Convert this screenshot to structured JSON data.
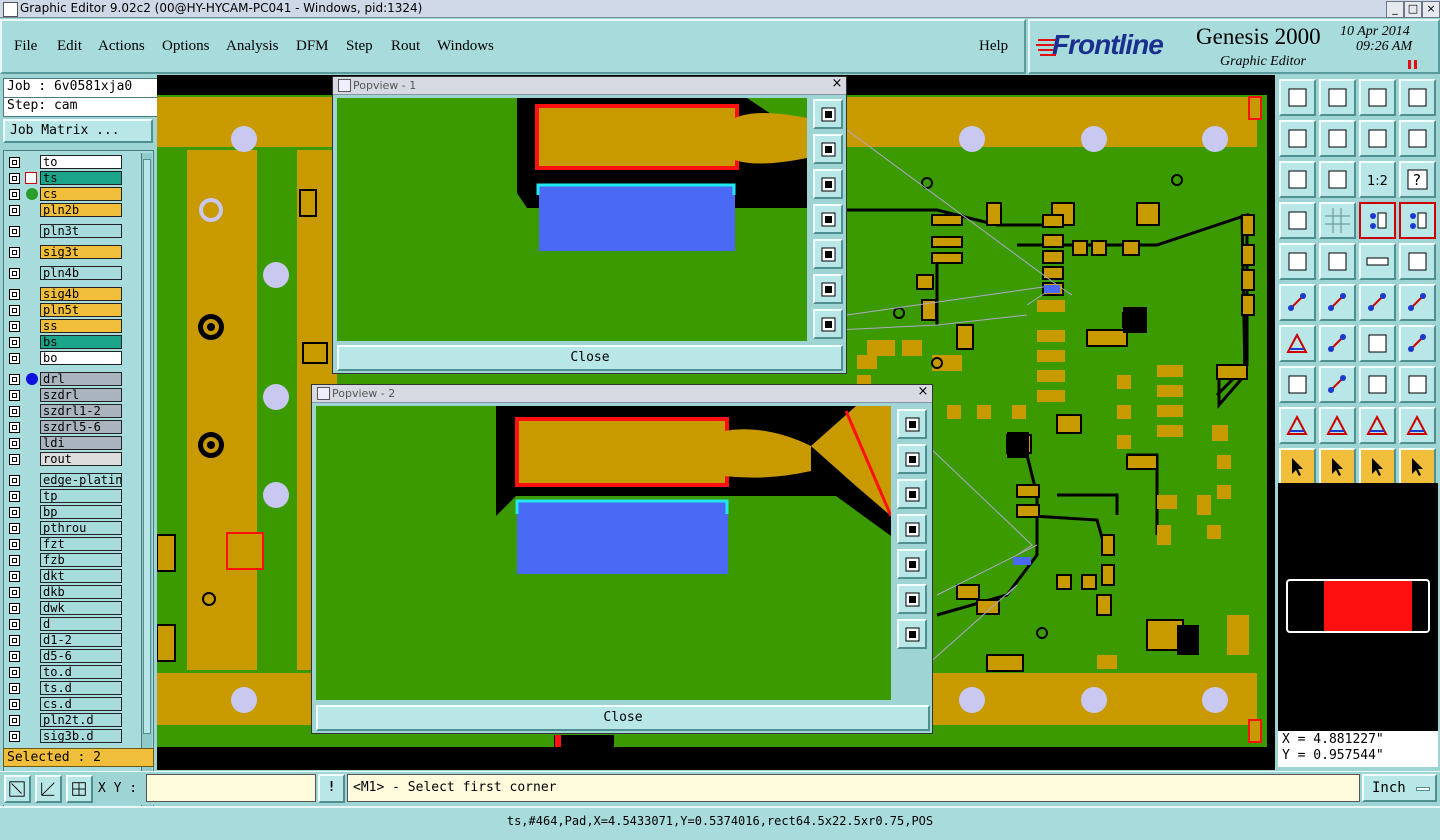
{
  "window": {
    "title": "Graphic Editor 9.02c2 (00@HY-HYCAM-PC041 - Windows, pid:1324)",
    "minimize": "_",
    "maximize": "□",
    "close": "×"
  },
  "menu": {
    "items": [
      "File",
      "Edit",
      "Actions",
      "Options",
      "Analysis",
      "DFM",
      "Step",
      "Rout",
      "Windows"
    ],
    "help": "Help"
  },
  "brand": {
    "logo": "Frontline",
    "product": "Genesis 2000",
    "subtitle": "Graphic Editor",
    "date": "10 Apr 2014",
    "time": "09:26 AM"
  },
  "job": {
    "job_label": "Job : 6v0581xja0",
    "step_label": "Step: cam",
    "matrix_button": "Job Matrix ..."
  },
  "layers": [
    {
      "name": "to",
      "color": "#ffffff"
    },
    {
      "name": "ts",
      "color": "#1aa58a",
      "active": true
    },
    {
      "name": "cs",
      "color": "#f0be3a"
    },
    {
      "name": "pln2b",
      "color": "#f0be3a"
    },
    {
      "name": "pln3t",
      "color": "#a8dcdc"
    },
    {
      "name": "sig3t",
      "color": "#f0be3a"
    },
    {
      "name": "pln4b",
      "color": "#a8dcdc"
    },
    {
      "name": "sig4b",
      "color": "#f0be3a"
    },
    {
      "name": "pln5t",
      "color": "#f0be3a"
    },
    {
      "name": "ss",
      "color": "#f0be3a"
    },
    {
      "name": "bs",
      "color": "#1aa58a"
    },
    {
      "name": "bo",
      "color": "#ffffff"
    },
    {
      "name": "drl",
      "color": "#a9b4bf"
    },
    {
      "name": "szdrl",
      "color": "#a9b4bf"
    },
    {
      "name": "szdrl1-2",
      "color": "#a9b4bf"
    },
    {
      "name": "szdrl5-6",
      "color": "#a9b4bf"
    },
    {
      "name": "ldi",
      "color": "#a9b4bf"
    },
    {
      "name": "rout",
      "color": "#dddddd"
    },
    {
      "name": "edge-plating",
      "color": "#a8dcdc"
    },
    {
      "name": "tp",
      "color": "#a8dcdc"
    },
    {
      "name": "bp",
      "color": "#a8dcdc"
    },
    {
      "name": "pthrou",
      "color": "#a8dcdc"
    },
    {
      "name": "fzt",
      "color": "#a8dcdc"
    },
    {
      "name": "fzb",
      "color": "#a8dcdc"
    },
    {
      "name": "dkt",
      "color": "#a8dcdc"
    },
    {
      "name": "dkb",
      "color": "#a8dcdc"
    },
    {
      "name": "dwk",
      "color": "#a8dcdc"
    },
    {
      "name": "d",
      "color": "#a8dcdc"
    },
    {
      "name": "d1-2",
      "color": "#a8dcdc"
    },
    {
      "name": "d5-6",
      "color": "#a8dcdc"
    },
    {
      "name": "to.d",
      "color": "#a8dcdc"
    },
    {
      "name": "ts.d",
      "color": "#a8dcdc"
    },
    {
      "name": "cs.d",
      "color": "#a8dcdc"
    },
    {
      "name": "pln2t.d",
      "color": "#a8dcdc"
    },
    {
      "name": "sig3b.d",
      "color": "#a8dcdc"
    }
  ],
  "selected": "Selected : 2",
  "popups": [
    {
      "title": "Popview - 1",
      "close": "Close"
    },
    {
      "title": "Popview - 2",
      "close": "Close"
    }
  ],
  "coords": {
    "x": "X = 4.881227\"",
    "y": "Y = 0.957544\""
  },
  "command": {
    "xy_label": "X Y :",
    "xy_value": "",
    "prompt": "<M1> - Select first corner",
    "units": "Inch"
  },
  "status": "ts,#464,Pad,X=4.5433071,Y=0.5374016,rect64.5x22.5xr0.75,POS",
  "colors": {
    "board": "#3a9a00",
    "copper": "#c99a00",
    "highlight_red": "#ff1010",
    "highlight_blue": "#4a6af5",
    "highlight_cyan": "#20e8f0",
    "hole": "#c8c8f0"
  }
}
